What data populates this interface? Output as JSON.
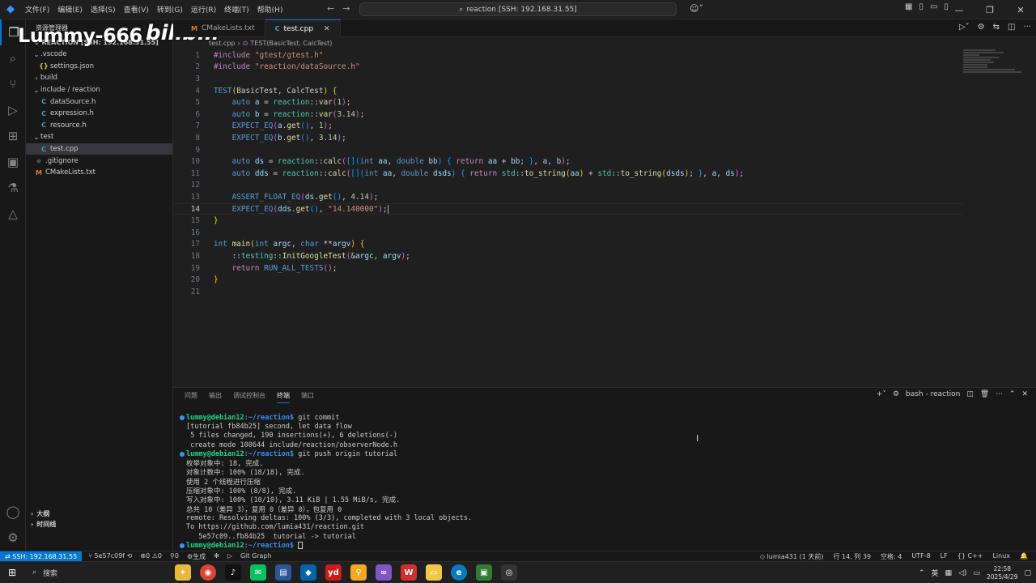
{
  "titlebar": {
    "menu": [
      "文件(F)",
      "编辑(E)",
      "选择(S)",
      "查看(V)",
      "转到(G)",
      "运行(R)",
      "终端(T)",
      "帮助(H)"
    ],
    "command_center": "reaction [SSH: 192.168.31.55]"
  },
  "watermark": {
    "user": "Lummy-666",
    "site": "bilibili"
  },
  "sidebar": {
    "header": "资源管理器",
    "root": "REACTION [SSH: 192.168.31.55]",
    "tree": [
      {
        "label": ".vscode",
        "type": "folder",
        "depth": 1,
        "open": true
      },
      {
        "label": "settings.json",
        "type": "json",
        "depth": 2
      },
      {
        "label": "build",
        "type": "folder",
        "depth": 1,
        "open": false
      },
      {
        "label": "include / reaction",
        "type": "folder",
        "depth": 1,
        "open": true
      },
      {
        "label": "dataSource.h",
        "type": "c",
        "depth": 2
      },
      {
        "label": "expression.h",
        "type": "c",
        "depth": 2
      },
      {
        "label": "resource.h",
        "type": "c",
        "depth": 2
      },
      {
        "label": "test",
        "type": "folder",
        "depth": 1,
        "open": true
      },
      {
        "label": "test.cpp",
        "type": "c",
        "depth": 2,
        "selected": true
      },
      {
        "label": ".gitignore",
        "type": "git",
        "depth": 1
      },
      {
        "label": "CMakeLists.txt",
        "type": "cmake",
        "depth": 1
      }
    ],
    "outline": "大纲",
    "timeline": "时间线"
  },
  "tabs": [
    {
      "label": "CMakeLists.txt",
      "icon": "M",
      "active": false
    },
    {
      "label": "test.cpp",
      "icon": "C",
      "active": true
    }
  ],
  "breadcrumb": {
    "file": "test.cpp",
    "symbol": "TEST(BasicTest, CalcTest)"
  },
  "code": {
    "current_line": 14,
    "line_numbers": [
      "1",
      "2",
      "3",
      "4",
      "5",
      "6",
      "7",
      "8",
      "9",
      "10",
      "11",
      "12",
      "13",
      "14",
      "15",
      "16",
      "17",
      "18",
      "19",
      "20",
      "21"
    ]
  },
  "panel": {
    "tabs": [
      "问题",
      "输出",
      "调试控制台",
      "终端",
      "端口"
    ],
    "active_tab": "终端",
    "terminal_name": "bash - reaction",
    "prompt_user": "lummy@debian12",
    "prompt_path": ":~/reaction$",
    "lines": [
      {
        "prompt": true,
        "text": " git commit"
      },
      {
        "prompt": false,
        "text": "[tutorial fb84b25] second, let data flow"
      },
      {
        "prompt": false,
        "text": " 5 files changed, 190 insertions(+), 6 deletions(-)"
      },
      {
        "prompt": false,
        "text": " create mode 100644 include/reaction/observerNode.h"
      },
      {
        "prompt": true,
        "text": " git push origin tutorial"
      },
      {
        "prompt": false,
        "text": "枚举对象中: 18, 完成."
      },
      {
        "prompt": false,
        "text": "对象计数中: 100% (18/18), 完成."
      },
      {
        "prompt": false,
        "text": "使用 2 个线程进行压缩"
      },
      {
        "prompt": false,
        "text": "压缩对象中: 100% (8/8), 完成."
      },
      {
        "prompt": false,
        "text": "写入对象中: 100% (10/10), 3.11 KiB | 1.55 MiB/s, 完成."
      },
      {
        "prompt": false,
        "text": "总共 10（差异 3），复用 0（差异 0），包复用 0"
      },
      {
        "prompt": false,
        "text": "remote: Resolving deltas: 100% (3/3), completed with 3 local objects."
      },
      {
        "prompt": false,
        "text": "To https://github.com/lumia431/reaction.git"
      },
      {
        "prompt": false,
        "text": "   5e57c09..fb84b25  tutorial -> tutorial"
      },
      {
        "prompt": true,
        "text": " "
      }
    ]
  },
  "statusbar": {
    "remote": "SSH: 192.168.31.55",
    "branch": "5e57c09f",
    "errors": "0",
    "warnings": "0",
    "ports": "0",
    "build": "生成",
    "git_graph": "Git Graph",
    "author": "lumia431 (1 天前)",
    "position": "行 14, 列 39",
    "spaces": "空格: 4",
    "encoding": "UTF-8",
    "eol": "LF",
    "language": "C++",
    "os": "Linux"
  },
  "taskbar": {
    "search": "搜索",
    "ime": "英",
    "time": "22:58",
    "date": "2025/4/29"
  }
}
